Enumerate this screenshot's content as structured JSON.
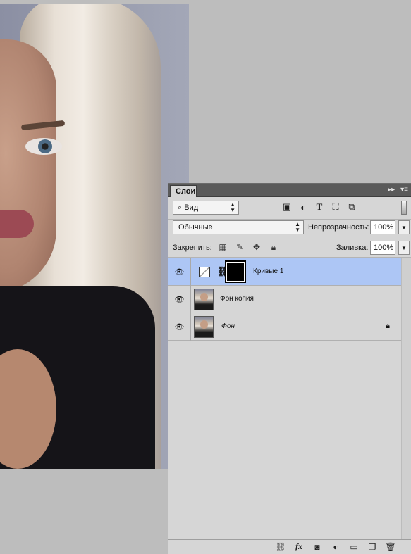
{
  "panel": {
    "tab_label": "Слои",
    "tab_controls": [
      "▸▸",
      "▾≡"
    ],
    "filter": {
      "kind_label": "Вид",
      "icons": [
        "image-icon",
        "adjustment-icon",
        "type-icon",
        "shape-icon",
        "smart-object-icon"
      ]
    },
    "blend_mode": "Обычные",
    "opacity_label": "Непрозрачность:",
    "opacity_value": "100%",
    "lock_label": "Закрепить:",
    "fill_label": "Заливка:",
    "fill_value": "100%"
  },
  "layers": [
    {
      "name": "Кривые 1",
      "type": "adjustment-curves",
      "visible": true,
      "selected": true,
      "locked": false
    },
    {
      "name": "Фон копия",
      "type": "pixel",
      "visible": true,
      "selected": false,
      "locked": false
    },
    {
      "name": "Фон",
      "type": "background",
      "visible": true,
      "selected": false,
      "locked": true
    }
  ],
  "footer_icons": [
    "link-icon",
    "fx-icon",
    "mask-icon",
    "new-adjustment-icon",
    "group-icon",
    "new-layer-icon",
    "trash-icon"
  ],
  "colors": {
    "selected_layer": "#adc6f5",
    "panel_bg": "#d6d6d6",
    "tab_bar": "#5a5a5a"
  }
}
